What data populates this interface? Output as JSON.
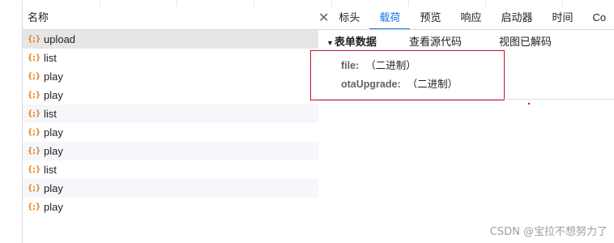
{
  "request_list": {
    "column_header": "名称",
    "icon": "xhr-braces-icon",
    "icon_glyph": "{;}",
    "items": [
      {
        "name": "upload"
      },
      {
        "name": "list"
      },
      {
        "name": "play"
      },
      {
        "name": "play"
      },
      {
        "name": "list"
      },
      {
        "name": "play"
      },
      {
        "name": "play"
      },
      {
        "name": "list"
      },
      {
        "name": "play"
      },
      {
        "name": "play"
      }
    ]
  },
  "details": {
    "close_icon": "close-icon",
    "close_glyph": "✕",
    "tabs": [
      "标头",
      "载荷",
      "预览",
      "响应",
      "启动器",
      "时间",
      "Co"
    ],
    "active_tab": "载荷",
    "section_title": "表单数据",
    "view_source": "查看源代码",
    "view_decoded": "视图已解码",
    "form_fields": [
      {
        "key": "file:",
        "value": "（二进制）"
      },
      {
        "key": "otaUpgrade:",
        "value": "（二进制）"
      }
    ]
  },
  "watermark": "CSDN @宝拉不想努力了",
  "colors": {
    "accent": "#1a73e8",
    "icon_orange": "#e37400",
    "highlight_box": "#c8102e",
    "selected_row": "#e6e6e6"
  }
}
